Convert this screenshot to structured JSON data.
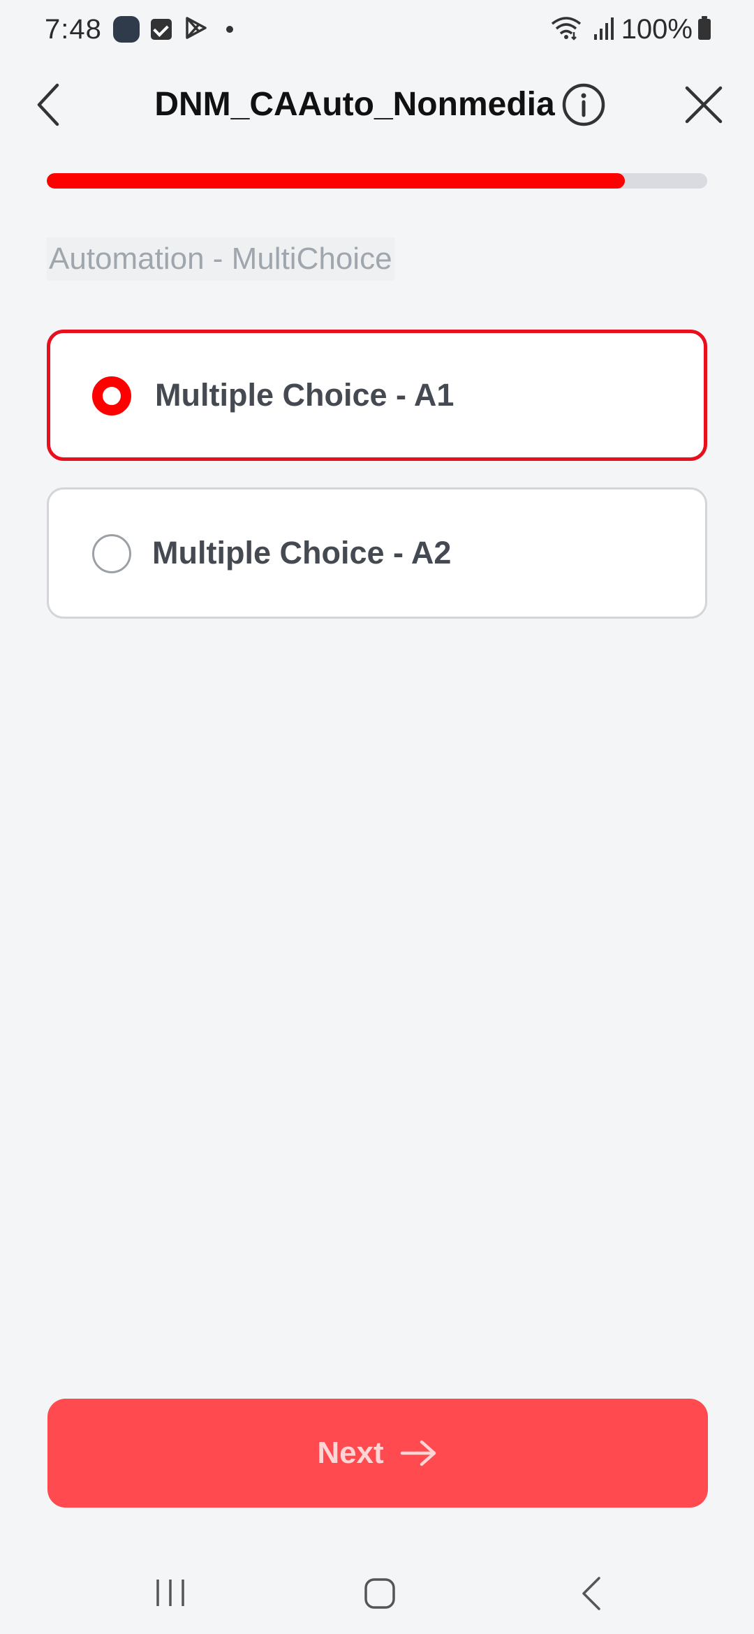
{
  "status_bar": {
    "time": "7:48",
    "battery": "100%",
    "icons": [
      "app-icon",
      "check-icon",
      "play-store-icon",
      "dot-icon",
      "wifi-icon",
      "signal-icon",
      "battery-icon"
    ]
  },
  "header": {
    "title": "DNM_CAAuto_Nonmedia",
    "back_icon": "chevron-left-icon",
    "info_icon": "info-icon",
    "close_icon": "close-icon"
  },
  "progress": {
    "fraction": 0.875,
    "color": "#ff0000"
  },
  "question": {
    "text": "Automation - MultiChoice"
  },
  "options": [
    {
      "label": "Multiple Choice - A1",
      "selected": true
    },
    {
      "label": "Multiple Choice - A2",
      "selected": false
    }
  ],
  "next_button": {
    "label": "Next",
    "icon": "arrow-right-icon",
    "color": "#ff4b4f"
  },
  "nav_bar": {
    "icons": [
      "recent-apps-icon",
      "home-icon",
      "back-icon"
    ]
  },
  "colors": {
    "accent": "#ff0000",
    "background": "#f4f5f7"
  }
}
